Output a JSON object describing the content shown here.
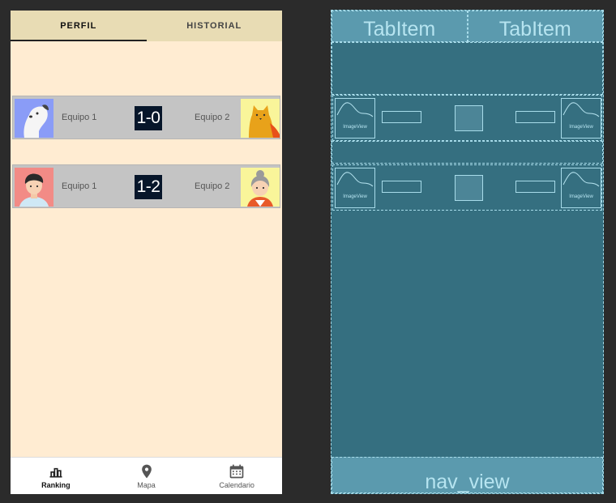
{
  "preview": {
    "tabs": [
      {
        "label": "PERFIL",
        "active": true
      },
      {
        "label": "HISTORIAL",
        "active": false
      }
    ],
    "matches": [
      {
        "home_team": "Equipo 1",
        "score": "1-0",
        "away_team": "Equipo 2",
        "home_avatar": "dog-avatar",
        "away_avatar": "cat-avatar"
      },
      {
        "home_team": "Equipo 1",
        "score": "1-2",
        "away_team": "Equipo 2",
        "home_avatar": "boy-avatar",
        "away_avatar": "grandma-avatar"
      }
    ],
    "nav": [
      {
        "label": "Ranking",
        "icon": "bar-chart-icon",
        "active": true
      },
      {
        "label": "Mapa",
        "icon": "map-pin-icon",
        "active": false
      },
      {
        "label": "Calendario",
        "icon": "calendar-icon",
        "active": false
      }
    ]
  },
  "blueprint": {
    "tabs": [
      "TabItem",
      "TabItem"
    ],
    "image_view_label": "ImageView",
    "nav_view_label": "nav_view"
  },
  "colors": {
    "preview_background": "#ffecd2",
    "tabbar": "#e8dcb4",
    "match_row": "#c4c4c4",
    "score_background": "#07162a",
    "blueprint_background": "#356f80",
    "blueprint_outline": "#a8dcea"
  }
}
